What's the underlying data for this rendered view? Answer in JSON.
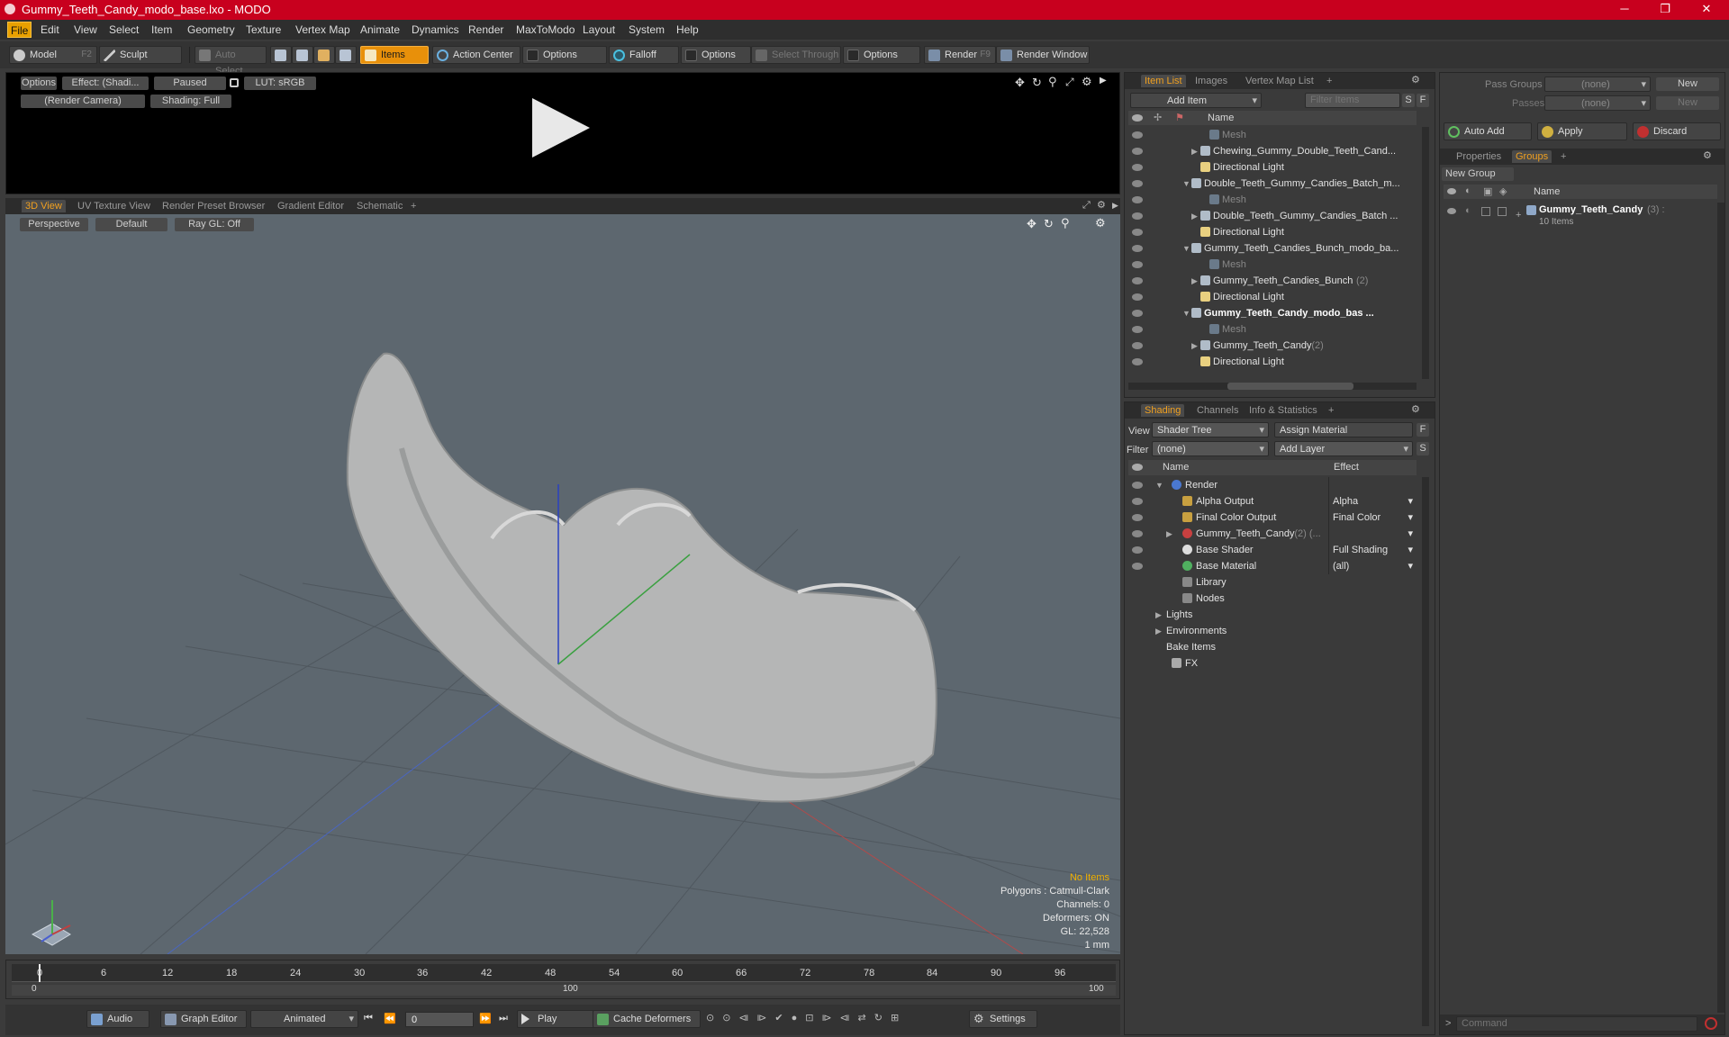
{
  "window": {
    "title": "Gummy_Teeth_Candy_modo_base.lxo - MODO",
    "minimize": "─",
    "maximize": "❐",
    "close": "✕"
  },
  "menu": [
    "File",
    "Edit",
    "View",
    "Select",
    "Item",
    "Geometry",
    "Texture",
    "Vertex Map",
    "Animate",
    "Dynamics",
    "Render",
    "MaxToModo",
    "Layout",
    "System",
    "Help"
  ],
  "toolbar": {
    "model": "Model",
    "model_key": "F2",
    "sculpt": "Sculpt",
    "auto_select": "Auto Select",
    "items": "Items",
    "action_center": "Action Center",
    "options1": "Options",
    "falloff": "Falloff",
    "options2": "Options",
    "select_through": "Select Through",
    "options3": "Options",
    "render": "Render",
    "render_key": "F9",
    "render_window": "Render Window"
  },
  "preview": {
    "options": "Options",
    "effect": "Effect: (Shadi...",
    "paused": "Paused",
    "lut": "LUT: sRGB",
    "camera": "(Render Camera)",
    "shading": "Shading: Full"
  },
  "viewport_tabs": [
    "3D View",
    "UV Texture View",
    "Render Preset Browser",
    "Gradient Editor",
    "Schematic",
    "+"
  ],
  "viewport": {
    "perspective": "Perspective",
    "default": "Default",
    "raygl": "Ray GL: Off",
    "hud": [
      "No Items",
      "Polygons : Catmull-Clark",
      "Channels: 0",
      "Deformers: ON",
      "GL: 22,528",
      "1 mm"
    ]
  },
  "timeline": {
    "ticks": [
      "0",
      "6",
      "12",
      "18",
      "24",
      "30",
      "36",
      "42",
      "48",
      "54",
      "60",
      "66",
      "72",
      "78",
      "84",
      "90",
      "96"
    ],
    "range_start": "0",
    "range_mid": "100",
    "range_end": "100"
  },
  "bottombar": {
    "audio": "Audio",
    "graph_editor": "Graph Editor",
    "animated": "Animated",
    "frame": "0",
    "play": "Play",
    "cache": "Cache Deformers",
    "settings": "Settings"
  },
  "item_list": {
    "tabs": [
      "Item List",
      "Images",
      "Vertex Map List",
      "+"
    ],
    "add_item": "Add Item",
    "filter": "Filter Items",
    "s": "S",
    "f": "F",
    "col_name": "Name",
    "rows": [
      {
        "label": "Mesh",
        "indent": 3,
        "style": "dim",
        "arrow": ""
      },
      {
        "label": "Chewing_Gummy_Double_Teeth_Cand...",
        "indent": 2,
        "style": "",
        "arrow": "▶"
      },
      {
        "label": "Directional Light",
        "indent": 2,
        "style": "",
        "arrow": ""
      },
      {
        "label": "Double_Teeth_Gummy_Candies_Batch_m...",
        "indent": 1,
        "style": "",
        "arrow": "▼"
      },
      {
        "label": "Mesh",
        "indent": 3,
        "style": "dim",
        "arrow": ""
      },
      {
        "label": "Double_Teeth_Gummy_Candies_Batch ...",
        "indent": 2,
        "style": "",
        "arrow": "▶"
      },
      {
        "label": "Directional Light",
        "indent": 2,
        "style": "",
        "arrow": ""
      },
      {
        "label": "Gummy_Teeth_Candies_Bunch_modo_ba...",
        "indent": 1,
        "style": "",
        "arrow": "▼"
      },
      {
        "label": "Mesh",
        "indent": 3,
        "style": "dim",
        "arrow": ""
      },
      {
        "label": "Gummy_Teeth_Candies_Bunch",
        "count": "(2)",
        "indent": 2,
        "style": "",
        "arrow": "▶"
      },
      {
        "label": "Directional Light",
        "indent": 2,
        "style": "",
        "arrow": ""
      },
      {
        "label": "Gummy_Teeth_Candy_modo_bas ...",
        "indent": 1,
        "style": "bold",
        "arrow": "▼"
      },
      {
        "label": "Mesh",
        "indent": 3,
        "style": "dim",
        "arrow": ""
      },
      {
        "label": "Gummy_Teeth_Candy",
        "count": "(2)",
        "indent": 2,
        "style": "",
        "arrow": "▶"
      },
      {
        "label": "Directional Light",
        "indent": 2,
        "style": "",
        "arrow": ""
      }
    ]
  },
  "shading": {
    "tabs": [
      "Shading",
      "Channels",
      "Info & Statistics",
      "+"
    ],
    "view_label": "View",
    "view_value": "Shader Tree",
    "assign": "Assign Material",
    "filter_label": "Filter",
    "filter_value": "(none)",
    "add_layer": "Add Layer",
    "f": "F",
    "s": "S",
    "col_name": "Name",
    "col_effect": "Effect",
    "rows": [
      {
        "label": "Render",
        "effect": "",
        "indent": 0,
        "arrow": "▼",
        "eye": true,
        "icon": "#4a78d0"
      },
      {
        "label": "Alpha Output",
        "effect": "Alpha",
        "indent": 1,
        "arrow": "",
        "eye": true,
        "icon": "#c8a040"
      },
      {
        "label": "Final Color Output",
        "effect": "Final Color",
        "indent": 1,
        "arrow": "",
        "eye": true,
        "icon": "#c8a040"
      },
      {
        "label": "Gummy_Teeth_Candy",
        "count": "(2) (...",
        "effect": "",
        "indent": 1,
        "arrow": "▶",
        "eye": true,
        "icon": "#c84040"
      },
      {
        "label": "Base Shader",
        "effect": "Full Shading",
        "indent": 1,
        "arrow": "",
        "eye": true,
        "icon": "#dddddd"
      },
      {
        "label": "Base Material",
        "effect": "(all)",
        "indent": 1,
        "arrow": "",
        "eye": true,
        "icon": "#50b060"
      },
      {
        "label": "Library",
        "effect": "",
        "indent": 1,
        "arrow": "",
        "eye": false,
        "icon": "#888888"
      },
      {
        "label": "Nodes",
        "effect": "",
        "indent": 1,
        "arrow": "",
        "eye": false,
        "icon": "#888888"
      },
      {
        "label": "Lights",
        "effect": "",
        "indent": 0,
        "arrow": "▶",
        "eye": false,
        "icon": ""
      },
      {
        "label": "Environments",
        "effect": "",
        "indent": 0,
        "arrow": "▶",
        "eye": false,
        "icon": ""
      },
      {
        "label": "Bake Items",
        "effect": "",
        "indent": 0,
        "arrow": "",
        "eye": false,
        "icon": ""
      },
      {
        "label": "FX",
        "effect": "",
        "indent": 0,
        "arrow": "",
        "eye": false,
        "icon": "#aaaaaa"
      }
    ]
  },
  "right": {
    "pass_groups": "Pass Groups",
    "passes": "Passes",
    "none": "(none)",
    "new": "New",
    "auto_add": "Auto Add",
    "apply": "Apply",
    "discard": "Discard",
    "tabs": [
      "Properties",
      "Groups",
      "+"
    ],
    "new_group": "New Group",
    "col_name": "Name",
    "group_name": "Gummy_Teeth_Candy",
    "group_count": "(3) :",
    "group_items": "10 Items",
    "command": "Command"
  }
}
